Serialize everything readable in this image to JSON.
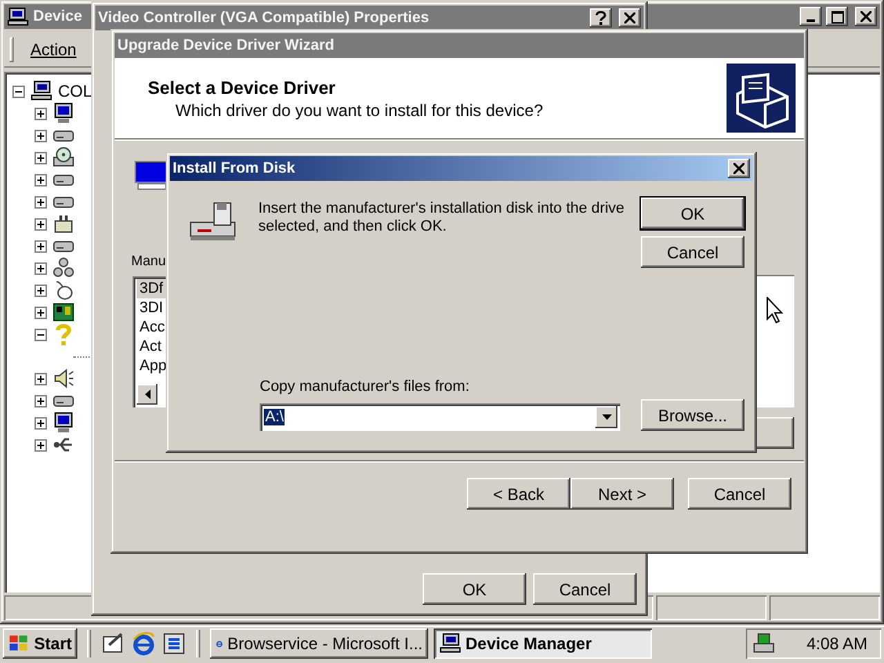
{
  "device_manager": {
    "title": "Device",
    "menu": [
      "Action"
    ],
    "tree": [
      {
        "label": "COL",
        "expanded": true,
        "children": [
          {
            "kind": "monitor",
            "expanded": false
          },
          {
            "kind": "drive",
            "expanded": false
          },
          {
            "kind": "cdrom",
            "expanded": false
          },
          {
            "kind": "drive",
            "expanded": false
          },
          {
            "kind": "drive",
            "expanded": false
          },
          {
            "kind": "port",
            "expanded": false
          },
          {
            "kind": "drive",
            "expanded": false
          },
          {
            "kind": "network",
            "expanded": false
          },
          {
            "kind": "mouse",
            "expanded": false
          },
          {
            "kind": "board",
            "expanded": false
          },
          {
            "kind": "unknown",
            "expanded": true
          },
          {
            "kind": "sound",
            "expanded": false
          },
          {
            "kind": "drive",
            "expanded": false
          },
          {
            "kind": "monitor",
            "expanded": false
          },
          {
            "kind": "usb",
            "expanded": false
          }
        ]
      }
    ]
  },
  "properties": {
    "title": "Video Controller (VGA Compatible) Properties",
    "buttons": [
      "OK",
      "Cancel"
    ]
  },
  "wizard": {
    "title": "Upgrade Device Driver Wizard",
    "heading": "Select a Device Driver",
    "subheading": "Which driver do you want to install for this device?",
    "manufacturer_label": "Manu",
    "manufacturers": [
      {
        "label": "3Df",
        "selected": true
      },
      {
        "label": "3DI",
        "selected": false
      },
      {
        "label": "Acc",
        "selected": false
      },
      {
        "label": "Act",
        "selected": false
      },
      {
        "label": "App",
        "selected": false
      }
    ],
    "buttons": [
      "< Back",
      "Next >",
      "Cancel"
    ]
  },
  "dialog": {
    "title": "Install From Disk",
    "message_lines": [
      "Insert the manufacturer's installation disk into the drive",
      "selected, and then click OK."
    ],
    "buttons": [
      "OK",
      "Cancel"
    ],
    "copy_label": "Copy manufacturer's files from:",
    "path": "A:\\",
    "browse": "Browse..."
  },
  "taskbar": {
    "start": "Start",
    "tasks": [
      {
        "label": "Browservice - Microsoft I...",
        "selected": false
      },
      {
        "label": "Device Manager",
        "selected": true
      }
    ],
    "clock": "4:08 AM"
  }
}
